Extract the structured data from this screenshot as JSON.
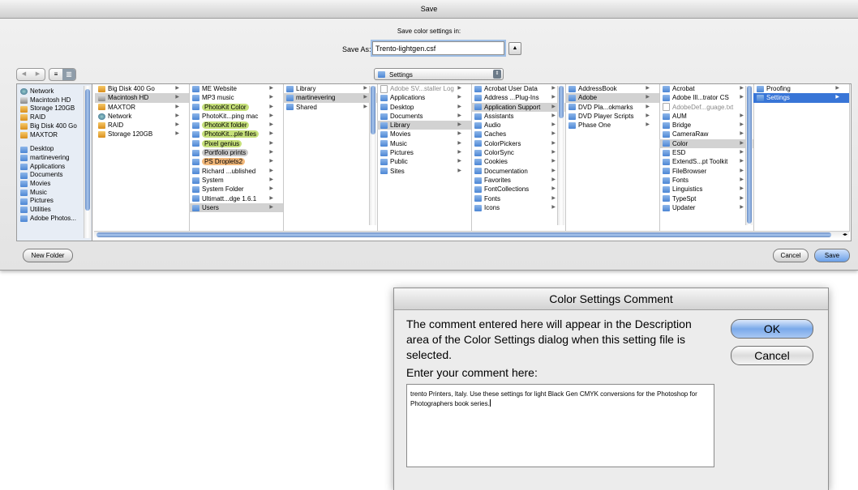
{
  "save_dialog": {
    "title": "Save",
    "subtitle": "Save color settings in:",
    "save_as_label": "Save As:",
    "save_as_value": "Trento-lightgen.csf",
    "nav_back": "◀",
    "nav_forward": "▶",
    "view_list": "≡",
    "view_columns": "▥",
    "location": "Settings",
    "sidebar": {
      "devices": [
        "Network",
        "Macintosh HD",
        "Storage 120GB",
        "RAID",
        "Big Disk 400 Go",
        "MAXTOR"
      ],
      "places": [
        "Desktop",
        "martinevering",
        "Applications",
        "Documents",
        "Movies",
        "Music",
        "Pictures",
        "Utilities",
        "Adobe Photos..."
      ]
    },
    "columns": [
      {
        "items": [
          {
            "name": "Big Disk 400 Go",
            "icon": "drive-icon",
            "arrow": true
          },
          {
            "name": "Macintosh HD",
            "icon": "hd-icon",
            "arrow": true,
            "state": "grey"
          },
          {
            "name": "MAXTOR",
            "icon": "drive-icon",
            "arrow": true
          },
          {
            "name": "Network",
            "icon": "network-icon",
            "arrow": true
          },
          {
            "name": "RAID",
            "icon": "drive-icon",
            "arrow": true
          },
          {
            "name": "Storage 120GB",
            "icon": "drive-icon",
            "arrow": true
          }
        ]
      },
      {
        "items": [
          {
            "name": "ME Website",
            "arrow": true
          },
          {
            "name": "MP3 music",
            "arrow": true
          },
          {
            "name": "PhotoKit Color",
            "arrow": true,
            "label": "#c6e07a"
          },
          {
            "name": "PhotoKit...ping mac",
            "arrow": true
          },
          {
            "name": "PhotoKit folder",
            "arrow": true,
            "label": "#c6e07a"
          },
          {
            "name": "PhotoKit...ple files",
            "arrow": true,
            "label": "#c6e07a"
          },
          {
            "name": "Pixel genius",
            "arrow": true,
            "label": "#c6e07a"
          },
          {
            "name": "Portfolio prints",
            "arrow": true,
            "label": "#c9c9c9"
          },
          {
            "name": "PS Droplets2",
            "arrow": true,
            "label": "#f2b87a"
          },
          {
            "name": "Richard ...ublished",
            "arrow": true
          },
          {
            "name": "System",
            "arrow": true
          },
          {
            "name": "System Folder",
            "arrow": true
          },
          {
            "name": "Ultimatt...dge 1.6.1",
            "arrow": true
          },
          {
            "name": "Users",
            "arrow": true,
            "state": "grey"
          }
        ]
      },
      {
        "items": [
          {
            "name": "Library",
            "arrow": true
          },
          {
            "name": "martinevering",
            "arrow": true,
            "state": "grey"
          },
          {
            "name": "Shared",
            "arrow": true
          }
        ]
      },
      {
        "items": [
          {
            "name": "Adobe SV...staller Log",
            "icon": "doc-icon",
            "arrow": true,
            "state": "dim"
          },
          {
            "name": "Applications",
            "arrow": true
          },
          {
            "name": "Desktop",
            "arrow": true
          },
          {
            "name": "Documents",
            "arrow": true
          },
          {
            "name": "Library",
            "arrow": true,
            "state": "grey"
          },
          {
            "name": "Movies",
            "arrow": true
          },
          {
            "name": "Music",
            "arrow": true
          },
          {
            "name": "Pictures",
            "arrow": true
          },
          {
            "name": "Public",
            "arrow": true
          },
          {
            "name": "Sites",
            "arrow": true
          }
        ]
      },
      {
        "items": [
          {
            "name": "Acrobat User Data",
            "arrow": true
          },
          {
            "name": "Address ...Plug-Ins",
            "arrow": true
          },
          {
            "name": "Application Support",
            "arrow": true,
            "state": "grey"
          },
          {
            "name": "Assistants",
            "arrow": true
          },
          {
            "name": "Audio",
            "arrow": true
          },
          {
            "name": "Caches",
            "arrow": true
          },
          {
            "name": "ColorPickers",
            "arrow": true
          },
          {
            "name": "ColorSync",
            "arrow": true
          },
          {
            "name": "Cookies",
            "arrow": true
          },
          {
            "name": "Documentation",
            "arrow": true
          },
          {
            "name": "Favorites",
            "arrow": true
          },
          {
            "name": "FontCollections",
            "arrow": true
          },
          {
            "name": "Fonts",
            "arrow": true
          },
          {
            "name": "Icons",
            "arrow": true
          }
        ]
      },
      {
        "items": [
          {
            "name": "AddressBook",
            "arrow": true
          },
          {
            "name": "Adobe",
            "arrow": true,
            "state": "grey"
          },
          {
            "name": "DVD Pla...okmarks",
            "arrow": true
          },
          {
            "name": "DVD Player Scripts",
            "arrow": true
          },
          {
            "name": "Phase One",
            "arrow": true
          }
        ]
      },
      {
        "items": [
          {
            "name": "Acrobat",
            "arrow": true
          },
          {
            "name": "Adobe Ill...trator CS",
            "arrow": true
          },
          {
            "name": "AdobeDef...guage.txt",
            "icon": "doc-icon",
            "arrow": false,
            "state": "dim"
          },
          {
            "name": "AUM",
            "arrow": true
          },
          {
            "name": "Bridge",
            "arrow": true
          },
          {
            "name": "CameraRaw",
            "arrow": true
          },
          {
            "name": "Color",
            "arrow": true,
            "state": "grey"
          },
          {
            "name": "ESD",
            "arrow": true
          },
          {
            "name": "ExtendS...pt Toolkit",
            "arrow": true
          },
          {
            "name": "FileBrowser",
            "arrow": true
          },
          {
            "name": "Fonts",
            "arrow": true
          },
          {
            "name": "Linguistics",
            "arrow": true
          },
          {
            "name": "TypeSpt",
            "arrow": true
          },
          {
            "name": "Updater",
            "arrow": true
          }
        ]
      },
      {
        "items": [
          {
            "name": "Proofing",
            "arrow": true
          },
          {
            "name": "Settings",
            "arrow": true,
            "state": "blue"
          }
        ]
      }
    ],
    "new_folder_label": "New Folder",
    "cancel_label": "Cancel",
    "save_label": "Save"
  },
  "comment_dialog": {
    "title": "Color Settings Comment",
    "description": "The comment entered here will appear in the Description area of the Color Settings dialog when this setting file is selected.",
    "prompt": "Enter your comment here:",
    "comment_value": "trento Printers, Italy. Use these settings for light Black Gen CMYK conversions for the Photoshop for Photographers book series.",
    "ok_label": "OK",
    "cancel_label": "Cancel"
  }
}
